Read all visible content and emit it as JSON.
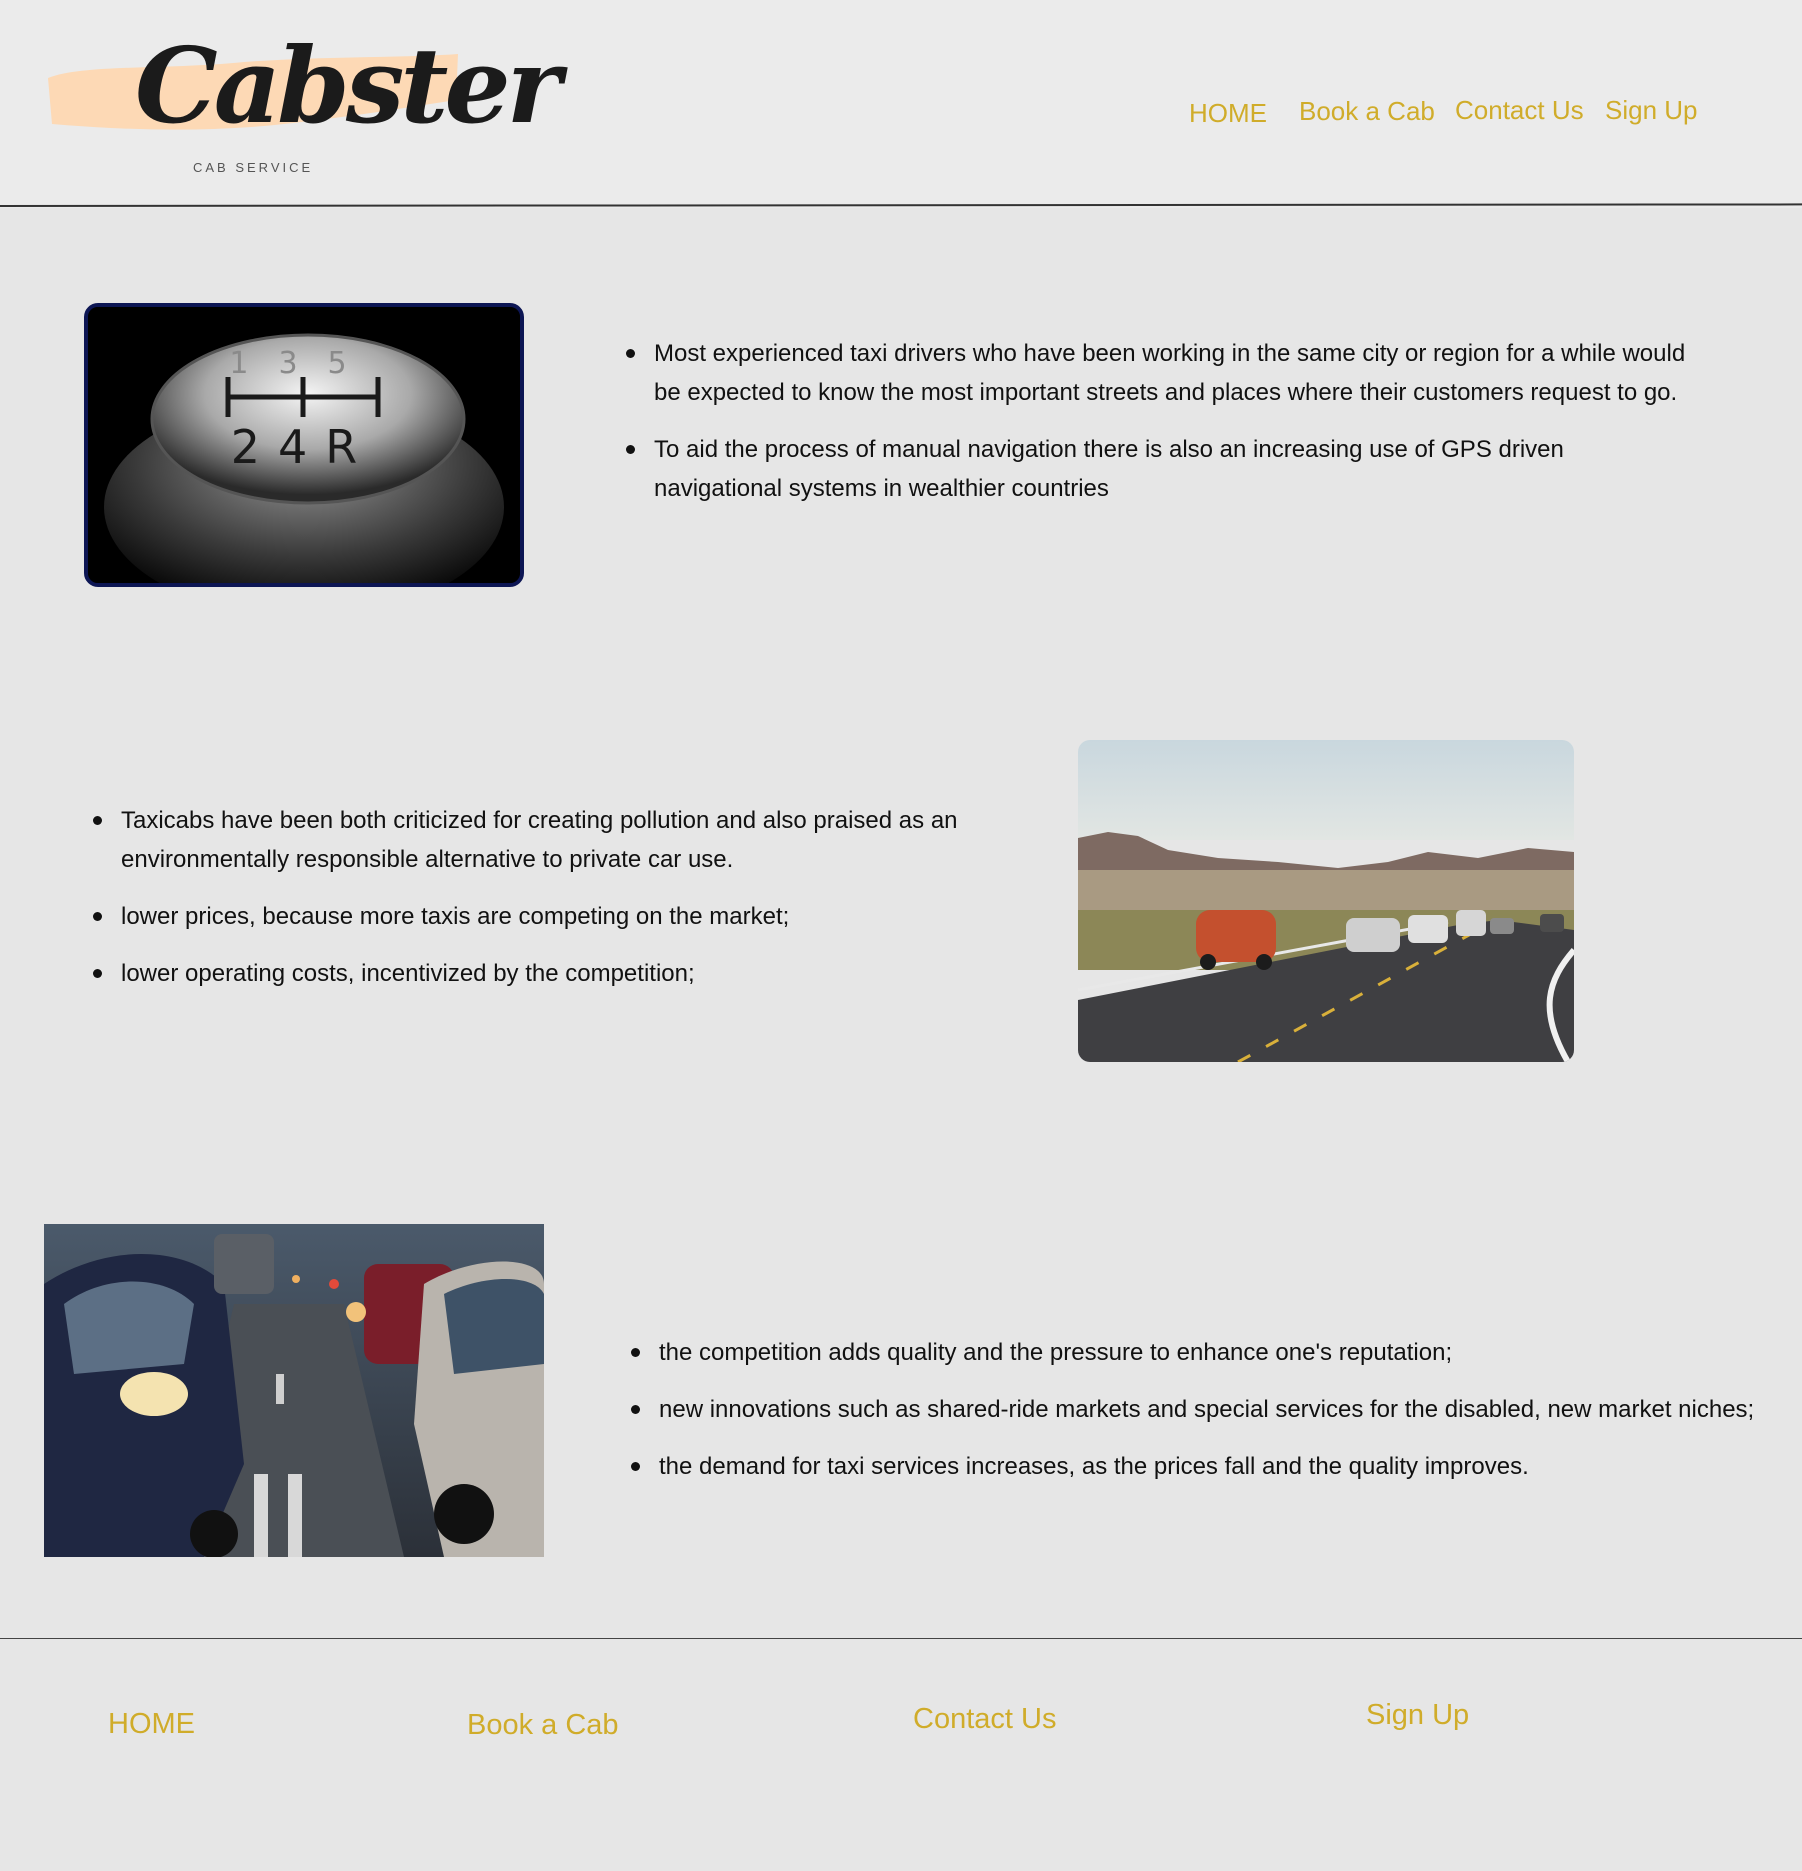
{
  "brand": {
    "name": "Cabster",
    "tagline": "CAB SERVICE",
    "brush_color": "#fdd9b5"
  },
  "nav": {
    "home": "HOME",
    "book": "Book a Cab",
    "contact": "Contact Us",
    "signup": "Sign Up",
    "link_color": "#d0ac2a"
  },
  "section1": {
    "image": "gear-shift-knob",
    "bullets": [
      "Most experienced taxi drivers who have been working in the same city or region for a while would be expected to know the most important streets and places where their customers request to go.",
      "To aid the process of manual navigation there is also an increasing use of GPS driven navigational systems in wealthier countries"
    ]
  },
  "section2": {
    "image": "highway-traffic",
    "bullets": [
      "Taxicabs have been both criticized for creating pollution and also praised as an environmentally responsible alternative to private car use.",
      "lower prices, because more taxis are competing on the market;",
      "lower operating costs, incentivized by the competition;"
    ]
  },
  "section3": {
    "image": "city-traffic-jam",
    "bullets": [
      "the competition adds quality and the pressure to enhance one's reputation;",
      "new innovations such as shared-ride markets and special services for the disabled, new market niches;",
      "the demand for taxi services increases, as the prices fall and the quality improves."
    ]
  },
  "footer": {
    "home": "HOME",
    "book": "Book a Cab",
    "contact": "Contact Us",
    "signup": "Sign Up"
  }
}
